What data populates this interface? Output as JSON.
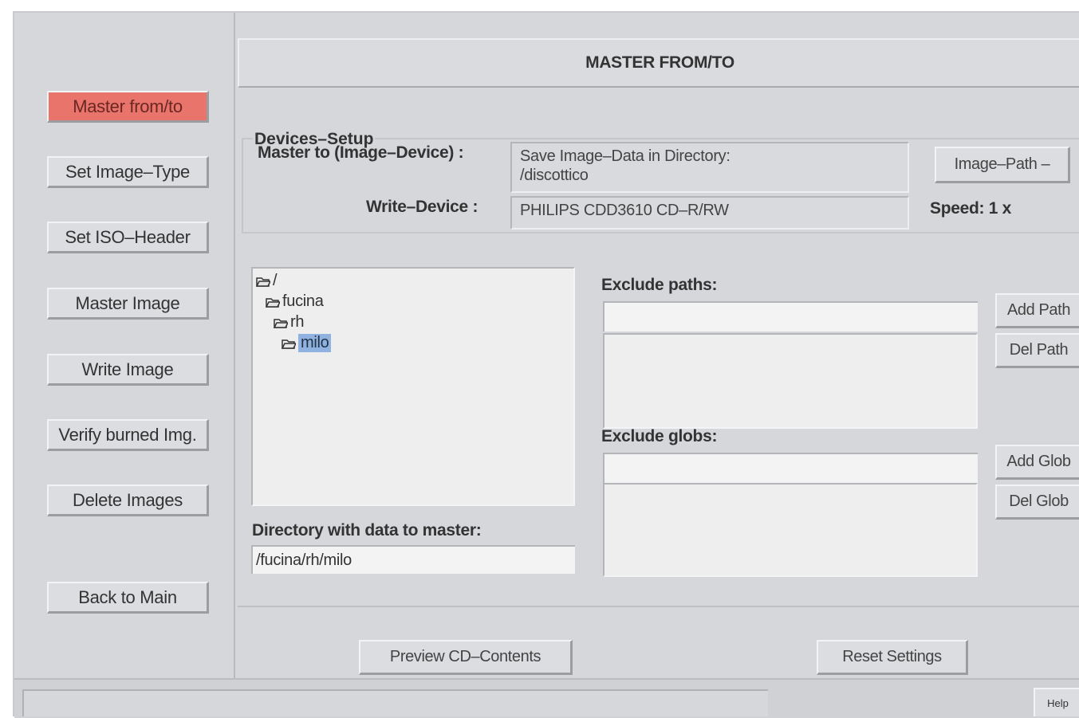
{
  "sidebar": {
    "items": [
      {
        "label": "Master from/to"
      },
      {
        "label": "Set Image–Type"
      },
      {
        "label": "Set ISO–Header"
      },
      {
        "label": "Master Image"
      },
      {
        "label": "Write Image"
      },
      {
        "label": "Verify burned Img."
      },
      {
        "label": "Delete Images"
      },
      {
        "label": "Back to Main"
      }
    ],
    "active_color": "#e8746b"
  },
  "header": {
    "title": "MASTER FROM/TO"
  },
  "devices": {
    "legend": "Devices–Setup",
    "master_to_label": "Master to (Image–Device) :",
    "master_to_line1": "Save Image–Data in Directory:",
    "master_to_line2": "/discottico",
    "image_path_button": "Image–Path –",
    "write_device_label": "Write–Device :",
    "write_device_value": "PHILIPS  CDD3610 CD–R/RW",
    "speed": "Speed: 1 x"
  },
  "tree": {
    "items": [
      {
        "label": "/"
      },
      {
        "label": "fucina"
      },
      {
        "label": "rh"
      },
      {
        "label": "milo",
        "selected": true
      }
    ],
    "selected_color": "#8fb2e0"
  },
  "directory": {
    "label": "Directory with data to master:",
    "value": "/fucina/rh/milo"
  },
  "exclude_paths": {
    "label": "Exclude paths:",
    "add_button": "Add Path",
    "del_button": "Del Path",
    "input_value": ""
  },
  "exclude_globs": {
    "label": "Exclude globs:",
    "add_button": "Add Glob",
    "del_button": "Del Glob",
    "input_value": ""
  },
  "footer": {
    "preview_button": "Preview CD–Contents",
    "reset_button": "Reset Settings"
  },
  "status_bar": {
    "help_button": "Help"
  }
}
